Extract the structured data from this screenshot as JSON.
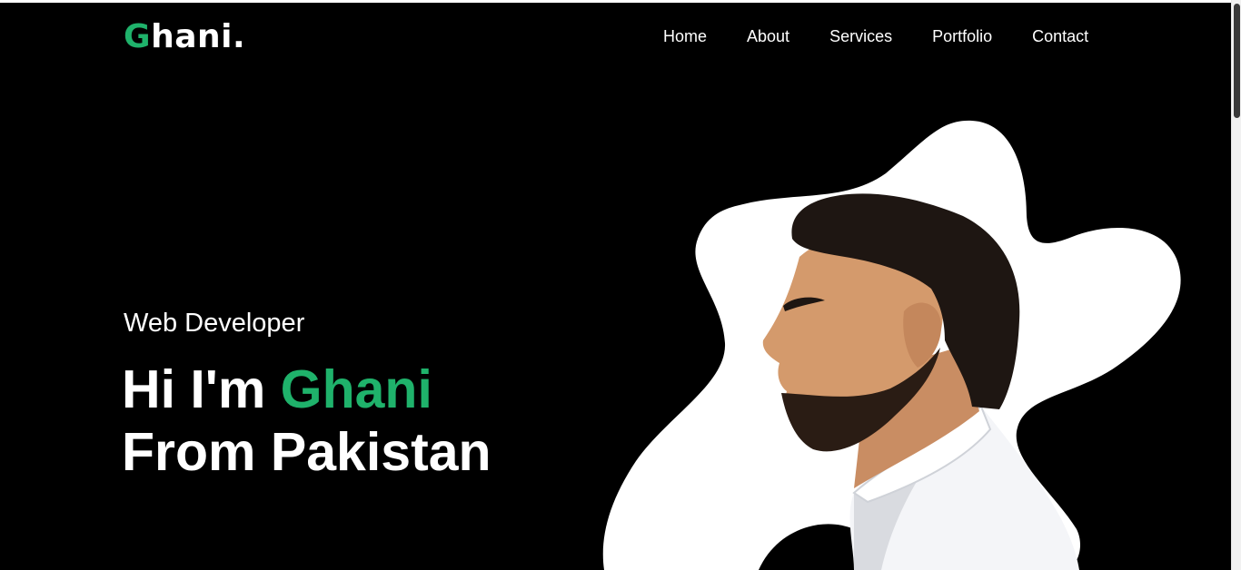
{
  "header": {
    "logo": {
      "initial": "G",
      "rest": "hani",
      "dot": "."
    },
    "nav": [
      "Home",
      "About",
      "Services",
      "Portfolio",
      "Contact"
    ]
  },
  "hero": {
    "role": "Web Developer",
    "greeting_prefix": "Hi I'm ",
    "name": "Ghani",
    "line2": "From Pakistan"
  },
  "colors": {
    "accent": "#1fb26b",
    "background": "#000000",
    "blob": "#ffffff",
    "text": "#ffffff"
  },
  "icons": {
    "portrait": "person-profile-photo"
  }
}
